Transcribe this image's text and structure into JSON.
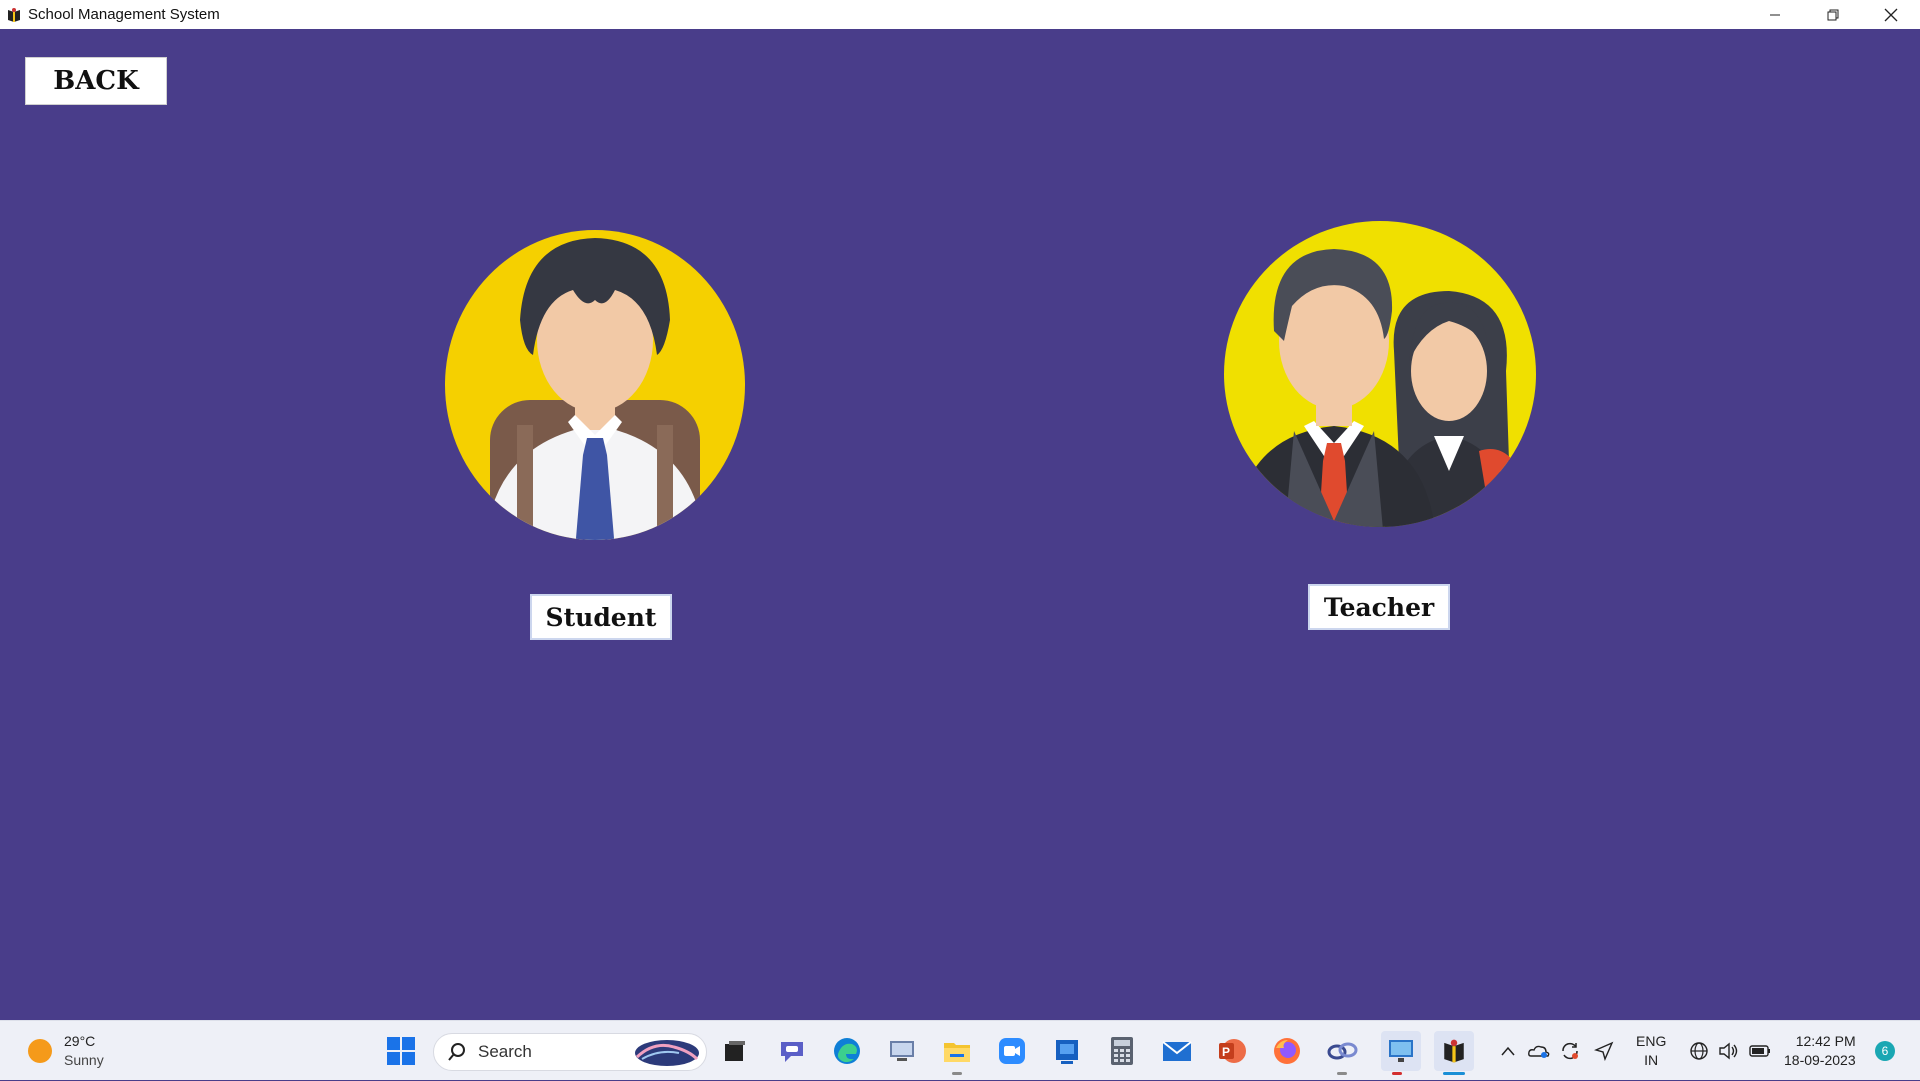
{
  "window": {
    "title": "School Management System",
    "controls": [
      "minimize",
      "restore",
      "close"
    ]
  },
  "main": {
    "back_label": "BACK",
    "roles": [
      {
        "label": "Student",
        "icon": "student-avatar-icon"
      },
      {
        "label": "Teacher",
        "icon": "teachers-avatar-icon"
      }
    ],
    "background_color": "#493d8a",
    "avatar_circle_color": "#f5d000"
  },
  "taskbar": {
    "weather": {
      "temp": "29°C",
      "condition": "Sunny"
    },
    "search_placeholder": "Search",
    "apps": [
      "start-icon",
      "search-icon",
      "task-view-icon",
      "teams-chat-icon",
      "edge-icon",
      "remote-desktop-icon",
      "file-explorer-icon",
      "zoom-icon",
      "store-icon",
      "calculator-icon",
      "mail-icon",
      "powerpoint-icon",
      "firefox-icon",
      "pipe-icon",
      "monitor-app-icon",
      "school-app-icon"
    ],
    "tray": {
      "language": "ENG",
      "region": "IN",
      "time": "12:42 PM",
      "date": "18-09-2023",
      "notifications": "6"
    }
  }
}
